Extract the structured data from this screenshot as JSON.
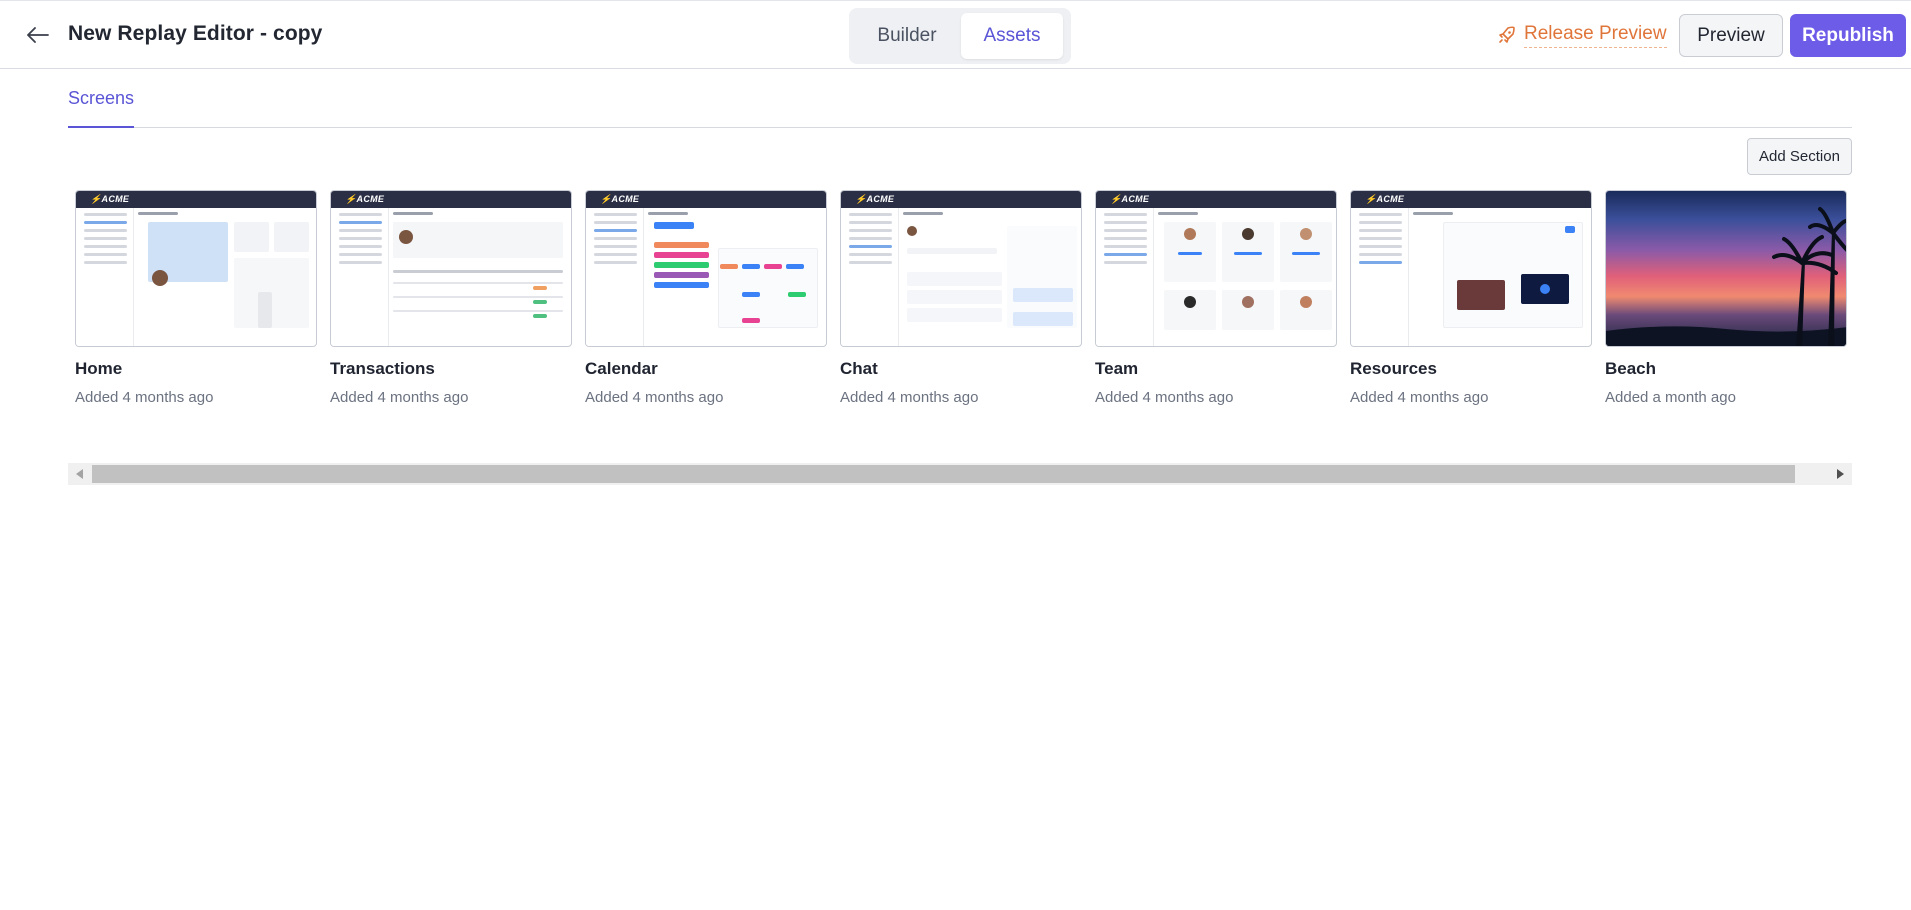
{
  "header": {
    "back_icon": "arrow-left-icon",
    "title": "New Replay Editor - copy",
    "tabs": [
      {
        "label": "Builder",
        "active": false
      },
      {
        "label": "Assets",
        "active": true
      }
    ],
    "release_preview_label": "Release Preview",
    "release_icon": "rocket-icon",
    "preview_label": "Preview",
    "republish_label": "Republish"
  },
  "section_tabs": [
    {
      "label": "Screens",
      "active": true
    }
  ],
  "add_section_label": "Add Section",
  "thumbnail_logo": "ACME",
  "screens": [
    {
      "name": "Home",
      "added": "Added 4 months ago"
    },
    {
      "name": "Transactions",
      "added": "Added 4 months ago"
    },
    {
      "name": "Calendar",
      "added": "Added 4 months ago"
    },
    {
      "name": "Chat",
      "added": "Added 4 months ago"
    },
    {
      "name": "Team",
      "added": "Added 4 months ago"
    },
    {
      "name": "Resources",
      "added": "Added 4 months ago"
    },
    {
      "name": "Beach",
      "added": "Added a month ago"
    }
  ],
  "colors": {
    "accent": "#6c5ce7",
    "tab_active": "#5a55d6",
    "release": "#e0753a",
    "mock_topbar": "#2a2f45"
  }
}
